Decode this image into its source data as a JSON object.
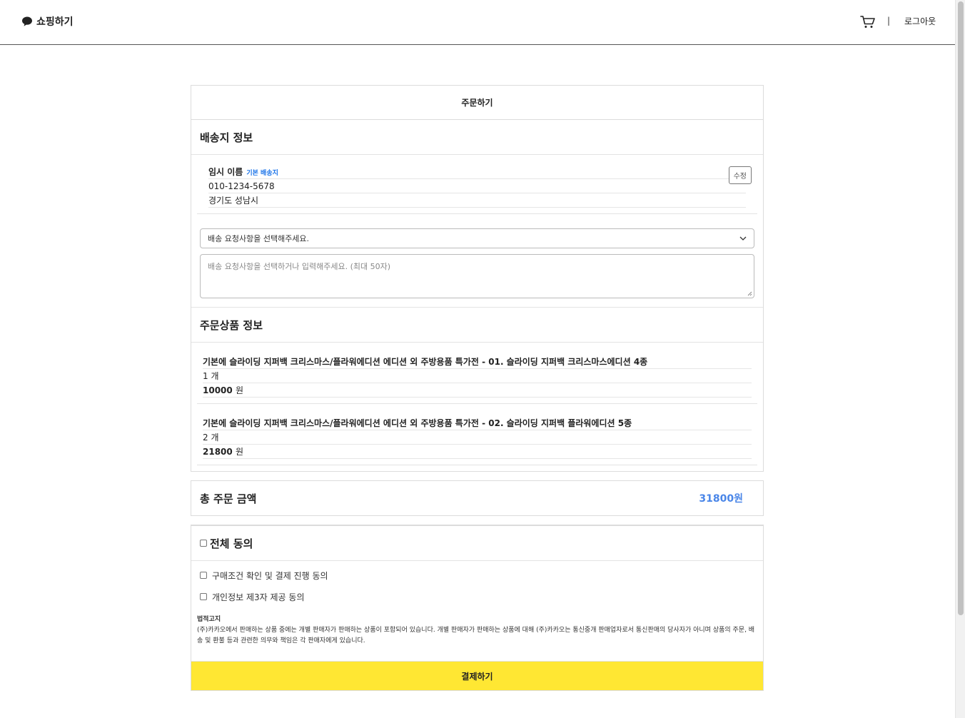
{
  "header": {
    "logo_text": "쇼핑하기",
    "separator": "|",
    "logout_label": "로그아웃"
  },
  "order": {
    "title": "주문하기",
    "shipping_section_title": "배송지 정보",
    "address": {
      "name": "임시 이름",
      "default_tag": "기본 배송지",
      "phone": "010-1234-5678",
      "address": "경기도 성남시",
      "edit_label": "수정"
    },
    "request_select": "배송 요청사항을 선택해주세요.",
    "request_placeholder": "배송 요청사항을 선택하거나 입력해주세요. (최대 50자)",
    "products_section_title": "주문상품 정보",
    "products": [
      {
        "name": "기본에 슬라이딩 지퍼백 크리스마스/플라워에디션 에디션 외 주방용품 특가전 - 01. 슬라이딩 지퍼백 크리스마스에디션 4종",
        "quantity": "1 개",
        "price": "10000",
        "currency": "원"
      },
      {
        "name": "기본에 슬라이딩 지퍼백 크리스마스/플라워에디션 에디션 외 주방용품 특가전 - 02. 슬라이딩 지퍼백 플라워에디션 5종",
        "quantity": "2 개",
        "price": "21800",
        "currency": "원"
      }
    ],
    "total_label": "총 주문 금액",
    "total_value": "31800원",
    "agree_all": "전체 동의",
    "agree_items": [
      "구매조건 확인 및 결제 진행 동의",
      "개인정보 제3자 제공 동의"
    ],
    "legal_title": "법적고지",
    "legal_text": "(주)카카오에서 판매하는 상품 중에는 개별 판매자가 판매하는 상품이 포함되어 있습니다. 개별 판매자가 판매하는 상품에 대해 (주)카카오는 통신중개 판매업자로서 통신판매의 당사자가 아니며 상품의 주문, 배송 및 환불 등과 관련한 의무와 책임은 각 판매자에게 있습니다.",
    "pay_label": "결제하기"
  },
  "colors": {
    "accent_blue": "#4a86e8",
    "pay_yellow": "#ffe733"
  }
}
